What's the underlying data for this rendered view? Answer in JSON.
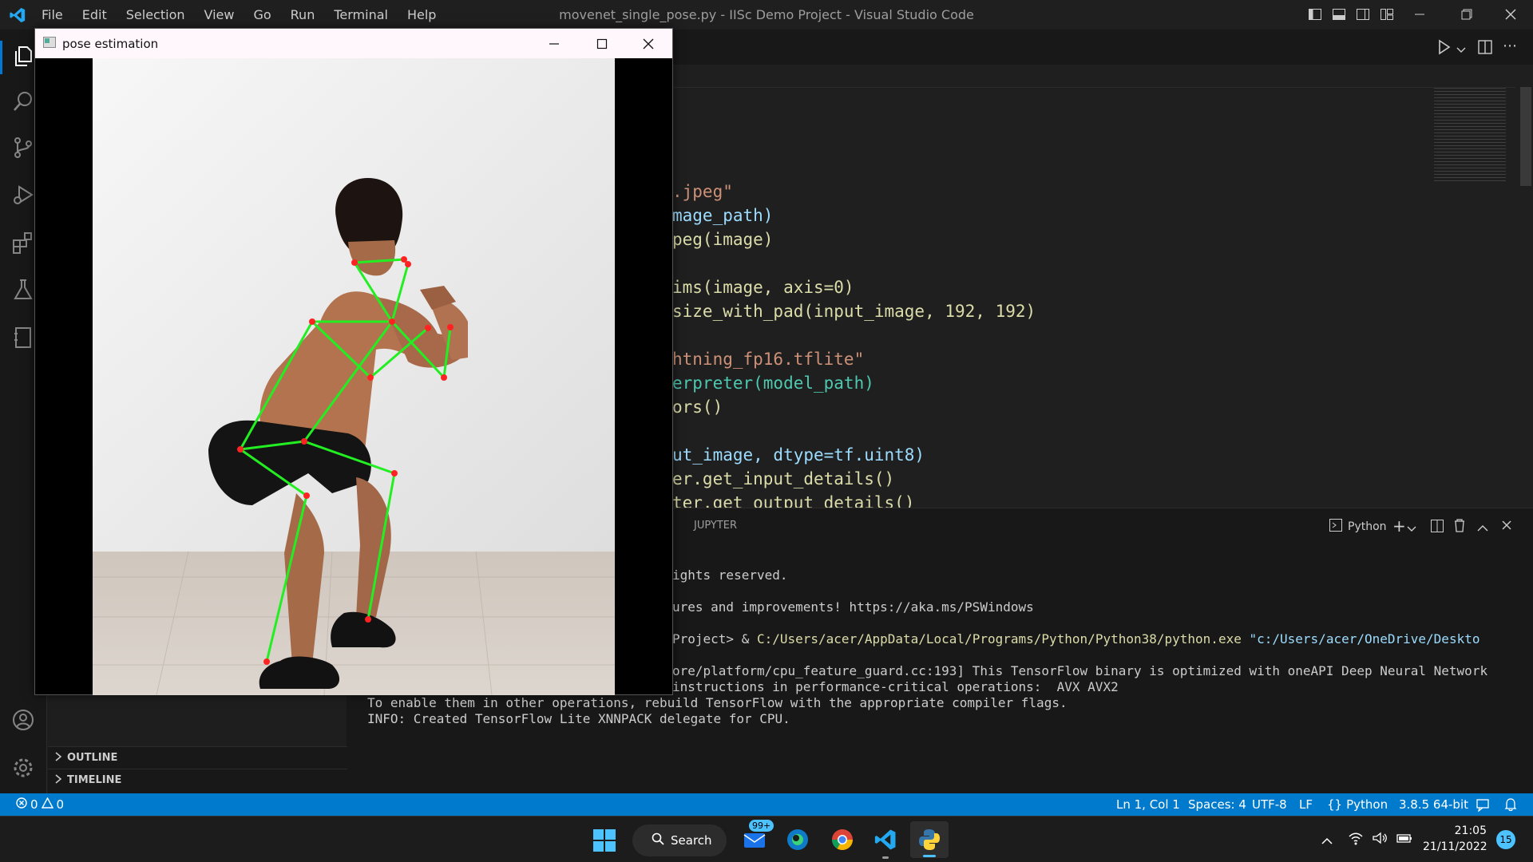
{
  "menu": [
    "File",
    "Edit",
    "Selection",
    "View",
    "Go",
    "Run",
    "Terminal",
    "Help"
  ],
  "window_title": "movenet_single_pose.py - IISc Demo Project - Visual Studio Code",
  "pose_window": {
    "title": "pose estimation"
  },
  "code_lines": [
    ".jpeg\"",
    "mage_path)",
    "peg(image)",
    "",
    "ims(image, axis=0)",
    "size_with_pad(input_image, 192, 192)",
    "",
    "htning_fp16.tflite\"",
    "erpreter(model_path)",
    "ors()",
    "",
    "ut_image, dtype=tf.uint8)",
    "er.get_input_details()",
    "ter.get_output_details()"
  ],
  "panel": {
    "tab": "JUPYTER",
    "profile": "Python",
    "lines": [
      "ights reserved.",
      "ures and improvements! https://aka.ms/PSWindows",
      "",
      "ore/platform/cpu_feature_guard.cc:193] This TensorFlow binary is optimized with oneAPI Deep Neural Network",
      "instructions in performance-critical operations:  AVX AVX2",
      "To enable them in other operations, rebuild TensorFlow with the appropriate compiler flags.",
      "INFO: Created TensorFlow Lite XNNPACK delegate for CPU."
    ],
    "prompt_prefix": "Project> & ",
    "prompt_exe": "C:/Users/acer/AppData/Local/Programs/Python/Python38/python.exe",
    "prompt_arg": "\"c:/Users/acer/OneDrive/Deskto"
  },
  "sidebar": {
    "outline": "OUTLINE",
    "timeline": "TIMELINE"
  },
  "status": {
    "errors": "0",
    "warnings": "0",
    "position": "Ln 1, Col 1",
    "spaces": "Spaces: 4",
    "encoding": "UTF-8",
    "eol": "LF",
    "language": "Python",
    "interpreter": "3.8.5 64-bit"
  },
  "taskbar": {
    "search": "Search",
    "mail_badge": "99+",
    "time": "21:05",
    "date": "21/11/2022",
    "notif_count": "15"
  }
}
